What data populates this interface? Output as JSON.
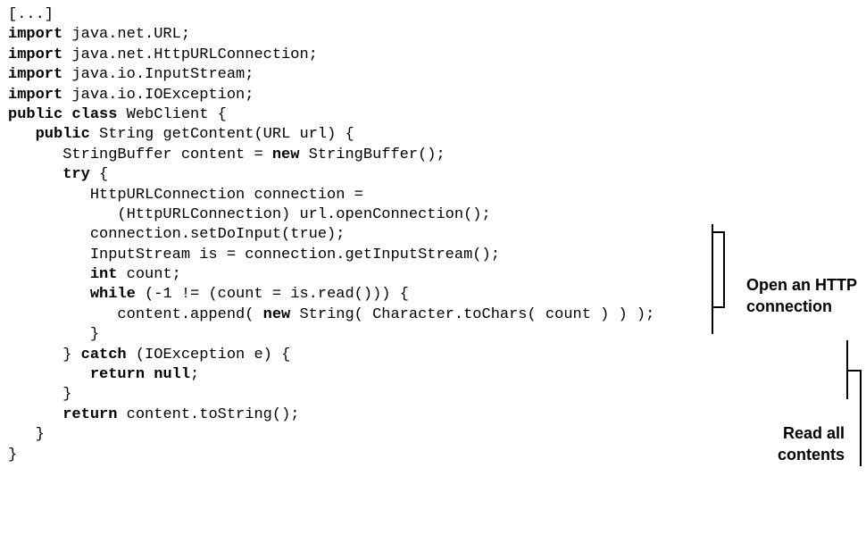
{
  "code": {
    "lines": [
      [
        {
          "t": "[...]"
        }
      ],
      [
        {
          "t": "import",
          "kw": true
        },
        {
          "t": " java.net.URL;"
        }
      ],
      [
        {
          "t": "import",
          "kw": true
        },
        {
          "t": " java.net.HttpURLConnection;"
        }
      ],
      [
        {
          "t": "import",
          "kw": true
        },
        {
          "t": " java.io.InputStream;"
        }
      ],
      [
        {
          "t": "import",
          "kw": true
        },
        {
          "t": " java.io.IOException;"
        }
      ],
      [
        {
          "t": "public class",
          "kw": true
        },
        {
          "t": " WebClient {"
        }
      ],
      [
        {
          "t": "   "
        },
        {
          "t": "public",
          "kw": true
        },
        {
          "t": " String getContent(URL url) {"
        }
      ],
      [
        {
          "t": "      StringBuffer content = "
        },
        {
          "t": "new",
          "kw": true
        },
        {
          "t": " StringBuffer();"
        }
      ],
      [
        {
          "t": "      "
        },
        {
          "t": "try",
          "kw": true
        },
        {
          "t": " {"
        }
      ],
      [
        {
          "t": "         HttpURLConnection connection ="
        }
      ],
      [
        {
          "t": "            (HttpURLConnection) url.openConnection();"
        }
      ],
      [
        {
          "t": "         connection.setDoInput(true);"
        }
      ],
      [
        {
          "t": "         InputStream is = connection.getInputStream();"
        }
      ],
      [
        {
          "t": "         "
        },
        {
          "t": "int",
          "kw": true
        },
        {
          "t": " count;"
        }
      ],
      [
        {
          "t": "         "
        },
        {
          "t": "while",
          "kw": true
        },
        {
          "t": " (-1 != (count = is.read())) {"
        }
      ],
      [
        {
          "t": "            content.append( "
        },
        {
          "t": "new",
          "kw": true
        },
        {
          "t": " String( Character.toChars( count ) ) );"
        }
      ],
      [
        {
          "t": "         }"
        }
      ],
      [
        {
          "t": "      } "
        },
        {
          "t": "catch",
          "kw": true
        },
        {
          "t": " (IOException e) {"
        }
      ],
      [
        {
          "t": "         "
        },
        {
          "t": "return null",
          "kw": true
        },
        {
          "t": ";"
        }
      ],
      [
        {
          "t": "      }"
        }
      ],
      [
        {
          "t": "      "
        },
        {
          "t": "return",
          "kw": true
        },
        {
          "t": " content.toString();"
        }
      ],
      [
        {
          "t": "   }"
        }
      ],
      [
        {
          "t": "}"
        }
      ]
    ]
  },
  "annotations": {
    "open_connection": [
      "Open an HTTP",
      "connection"
    ],
    "read_contents": [
      "Read all",
      "contents"
    ]
  }
}
